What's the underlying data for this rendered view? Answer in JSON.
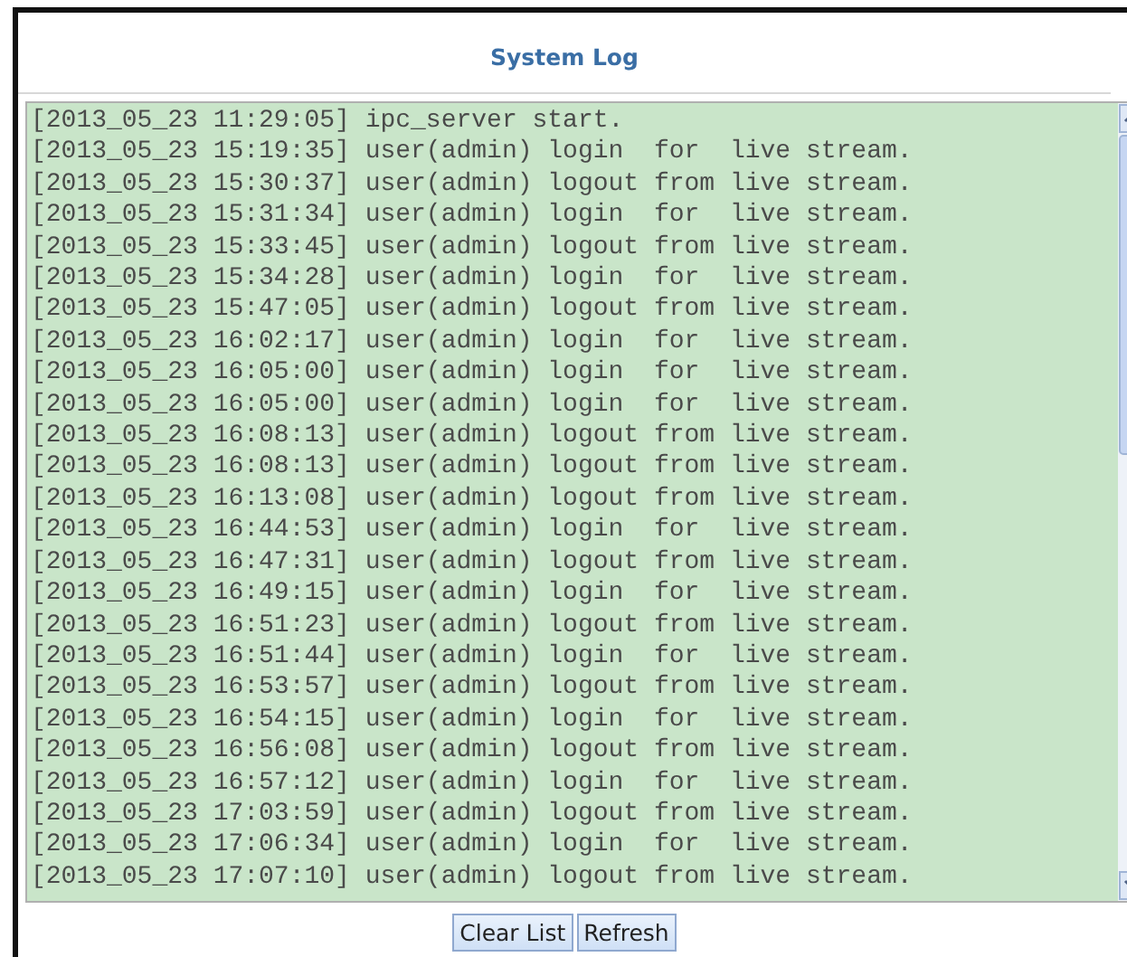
{
  "panel": {
    "title": "System Log"
  },
  "log_lines": [
    "[2013_05_23 11:29:05] ipc_server start.",
    "[2013_05_23 15:19:35] user(admin) login  for  live stream.",
    "[2013_05_23 15:30:37] user(admin) logout from live stream.",
    "[2013_05_23 15:31:34] user(admin) login  for  live stream.",
    "[2013_05_23 15:33:45] user(admin) logout from live stream.",
    "[2013_05_23 15:34:28] user(admin) login  for  live stream.",
    "[2013_05_23 15:47:05] user(admin) logout from live stream.",
    "[2013_05_23 16:02:17] user(admin) login  for  live stream.",
    "[2013_05_23 16:05:00] user(admin) login  for  live stream.",
    "[2013_05_23 16:05:00] user(admin) login  for  live stream.",
    "[2013_05_23 16:08:13] user(admin) logout from live stream.",
    "[2013_05_23 16:08:13] user(admin) logout from live stream.",
    "[2013_05_23 16:13:08] user(admin) logout from live stream.",
    "[2013_05_23 16:44:53] user(admin) login  for  live stream.",
    "[2013_05_23 16:47:31] user(admin) logout from live stream.",
    "[2013_05_23 16:49:15] user(admin) login  for  live stream.",
    "[2013_05_23 16:51:23] user(admin) logout from live stream.",
    "[2013_05_23 16:51:44] user(admin) login  for  live stream.",
    "[2013_05_23 16:53:57] user(admin) logout from live stream.",
    "[2013_05_23 16:54:15] user(admin) login  for  live stream.",
    "[2013_05_23 16:56:08] user(admin) logout from live stream.",
    "[2013_05_23 16:57:12] user(admin) login  for  live stream.",
    "[2013_05_23 17:03:59] user(admin) logout from live stream.",
    "[2013_05_23 17:06:34] user(admin) login  for  live stream.",
    "[2013_05_23 17:07:10] user(admin) logout from live stream."
  ],
  "buttons": [
    "Clear List",
    "Refresh"
  ]
}
